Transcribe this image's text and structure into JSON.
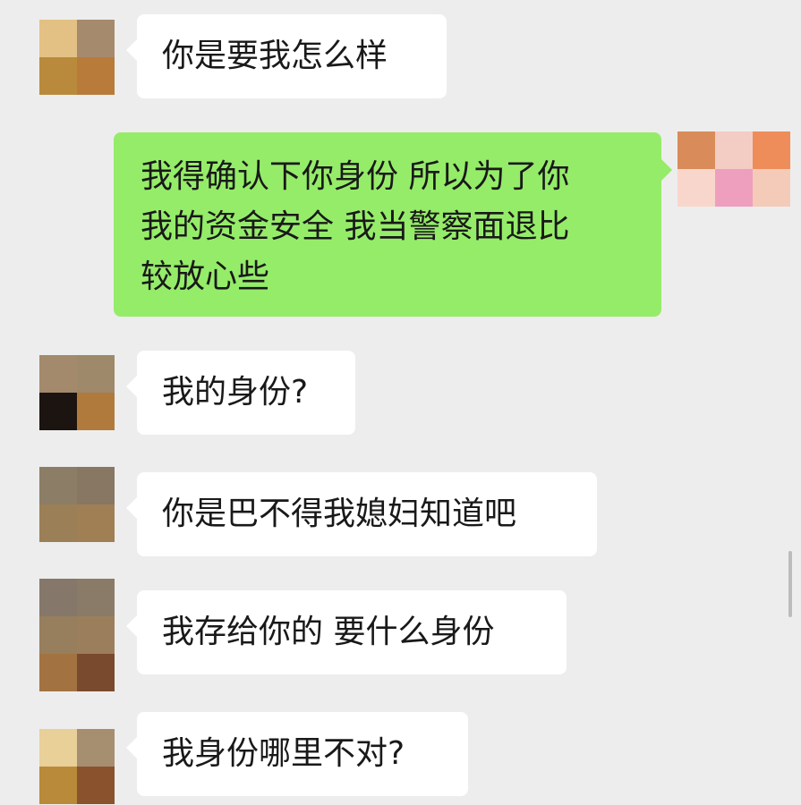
{
  "colors": {
    "background": "#ededed",
    "incoming_bubble": "#ffffff",
    "outgoing_bubble": "#95ec69",
    "text": "#191919"
  },
  "messages": [
    {
      "side": "left",
      "lines": [
        "你是要我怎么样"
      ]
    },
    {
      "side": "right",
      "lines": [
        "我得确认下你身份 所以为了你",
        "我的资金安全 我当警察面退比",
        "较放心些"
      ]
    },
    {
      "side": "left",
      "lines": [
        "我的身份?"
      ]
    },
    {
      "side": "left",
      "lines": [
        "你是巴不得我媳妇知道吧"
      ]
    },
    {
      "side": "left",
      "lines": [
        "我存给你的 要什么身份"
      ]
    },
    {
      "side": "left",
      "lines": [
        "我身份哪里不对?"
      ]
    }
  ],
  "avatars": {
    "contact_1": [
      "#e3c184",
      "#a68a6d",
      "#b98a3c",
      "#b87b3a"
    ],
    "self": [
      "#d98c5a",
      "#f3cdc4",
      "#ef8d5a",
      "#f8d6cc",
      "#ee9fbd",
      "#f4cbb8"
    ],
    "contact_2": [
      "#a38a6c",
      "#9e896b",
      "#1b1410",
      "#b07a3c"
    ],
    "contact_3": [
      "#8c7d66",
      "#877763",
      "#9a7f57",
      "#a07f55"
    ],
    "contact_4": [
      "#85786a",
      "#8a7b69",
      "#977e5d",
      "#9b7f5c",
      "#a27340",
      "#7a4a2e"
    ],
    "contact_5": [
      "#e9cf98",
      "#a68e71",
      "#b98a3a",
      "#8a532e"
    ]
  }
}
